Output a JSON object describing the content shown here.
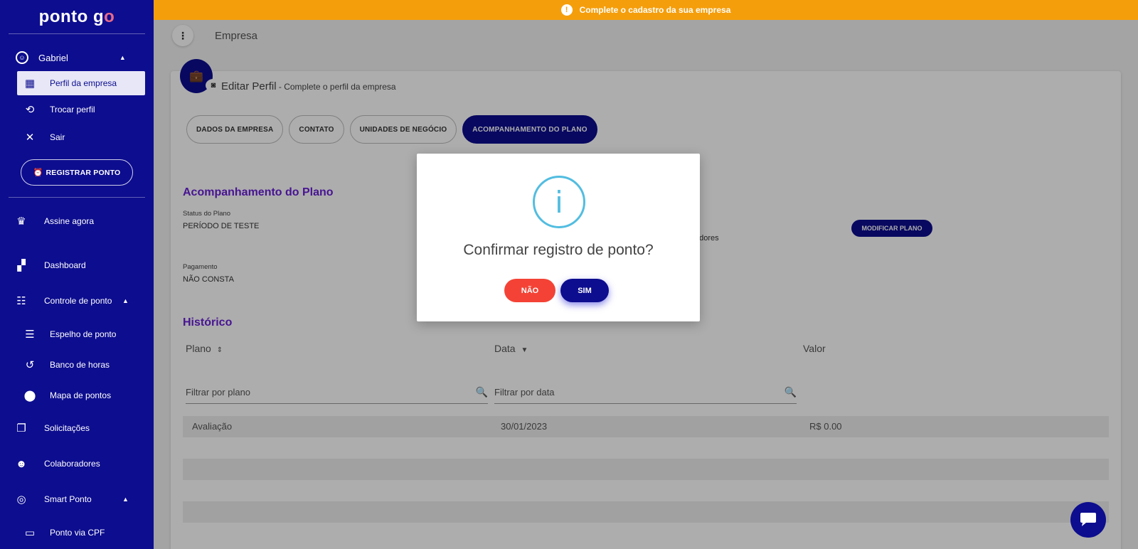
{
  "banner": {
    "text": "Complete o cadastro da sua empresa",
    "icon": "exclamation-icon"
  },
  "sidebar": {
    "logo_main": "ponto g",
    "logo_accent": "o",
    "user_name": "Gabriel",
    "user_menu": [
      {
        "label": "Perfil da empresa",
        "icon": "building-icon",
        "active": true
      },
      {
        "label": "Trocar perfil",
        "icon": "switch-user-icon"
      },
      {
        "label": "Sair",
        "icon": "close-icon"
      }
    ],
    "register_button": "REGISTRAR PONTO",
    "items": [
      {
        "label": "Assine agora",
        "icon": "crown-icon"
      },
      {
        "label": "Dashboard",
        "icon": "dashboard-icon"
      },
      {
        "label": "Controle de ponto",
        "icon": "timesheet-icon"
      },
      {
        "label": "Espelho de ponto",
        "icon": "list-icon"
      },
      {
        "label": "Banco de horas",
        "icon": "history-icon"
      },
      {
        "label": "Mapa de pontos",
        "icon": "location-pin-icon"
      },
      {
        "label": "Solicitações",
        "icon": "copy-icon"
      },
      {
        "label": "Colaboradores",
        "icon": "people-icon"
      },
      {
        "label": "Smart Ponto",
        "icon": "fingerprint-icon"
      },
      {
        "label": "Ponto via CPF",
        "icon": "laptop-icon"
      }
    ]
  },
  "header": {
    "page_name": "Empresa"
  },
  "profile": {
    "title": "Editar Perfil",
    "subtitle": " - Complete o perfil da empresa"
  },
  "tabs": [
    {
      "label": "DADOS DA EMPRESA"
    },
    {
      "label": "CONTATO"
    },
    {
      "label": "UNIDADES DE NEGÓCIO"
    },
    {
      "label": "ACOMPANHAMENTO DO PLANO",
      "active": true
    }
  ],
  "plan": {
    "section_title": "Acompanhamento do Plano",
    "status_label": "Status do Plano",
    "status_value": "PERÍODO DE TESTE",
    "payment_label": "Pagamento",
    "payment_value": "NÃO CONSTA",
    "partial_text": "adores",
    "modify_button": "MODIFICAR PLANO"
  },
  "history": {
    "section_title": "Histórico",
    "columns": [
      "Plano",
      "Data",
      "Valor"
    ],
    "filter_plan_placeholder": "Filtrar por plano",
    "filter_date_placeholder": "Filtrar por data",
    "rows": [
      {
        "plano": "Avaliação",
        "data": "30/01/2023",
        "valor": "R$ 0.00"
      }
    ]
  },
  "modal": {
    "title": "Confirmar registro de ponto?",
    "no_label": "NÃO",
    "yes_label": "SIM",
    "icon": "info-icon"
  },
  "colors": {
    "primary": "#0d0d8f",
    "warning": "#f59e0b",
    "danger": "#f44336",
    "info": "#52bde0",
    "section": "#6a20d8"
  }
}
